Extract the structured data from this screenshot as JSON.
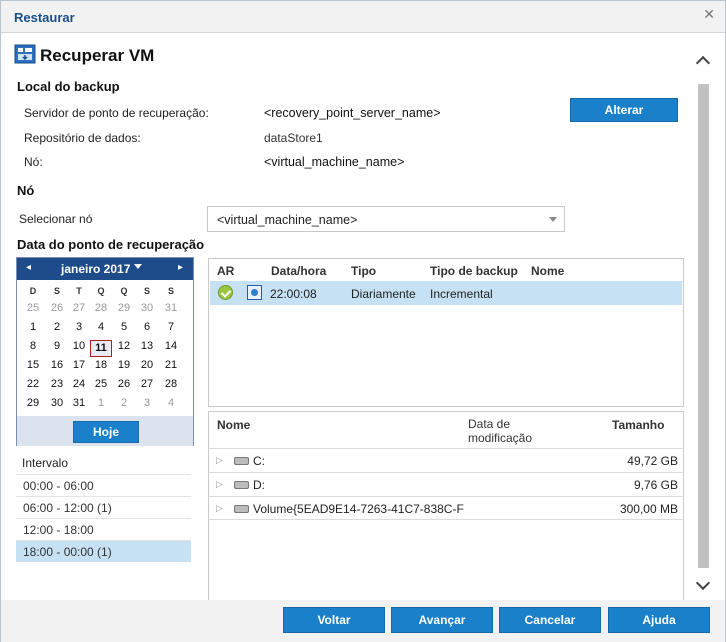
{
  "window": {
    "title": "Restaurar"
  },
  "header": {
    "title": "Recuperar VM"
  },
  "backup": {
    "section": "Local do backup",
    "server_label": "Servidor de ponto de recuperação:",
    "server_value": "<recovery_point_server_name>",
    "store_label": "Repositório de dados:",
    "store_value": "dataStore1",
    "node_label": "Nó:",
    "node_value": "<virtual_machine_name>",
    "change_button": "Alterar"
  },
  "node": {
    "section": "Nó",
    "select_label": "Selecionar nó",
    "select_value": "<virtual_machine_name>"
  },
  "recovery": {
    "section": "Data do ponto de recuperação"
  },
  "calendar": {
    "month": "janeiro 2017",
    "prev": "◂",
    "next": "▸",
    "dow": [
      "D",
      "S",
      "T",
      "Q",
      "Q",
      "S",
      "S"
    ],
    "weeks": [
      [
        "25",
        "26",
        "27",
        "28",
        "29",
        "30",
        "31"
      ],
      [
        "1",
        "2",
        "3",
        "4",
        "5",
        "6",
        "7"
      ],
      [
        "8",
        "9",
        "10",
        "11",
        "12",
        "13",
        "14"
      ],
      [
        "15",
        "16",
        "17",
        "18",
        "19",
        "20",
        "21"
      ],
      [
        "22",
        "23",
        "24",
        "25",
        "26",
        "27",
        "28"
      ],
      [
        "29",
        "30",
        "31",
        "1",
        "2",
        "3",
        "4"
      ]
    ],
    "today_button": "Hoje",
    "selected": "11"
  },
  "intervals": {
    "header": "Intervalo",
    "items": [
      "00:00 - 06:00",
      "06:00 - 12:00   (1)",
      "12:00 - 18:00",
      "18:00 - 00:00   (1)"
    ]
  },
  "points_table": {
    "headers": {
      "ar": "AR",
      "datetime": "Data/hora",
      "type": "Tipo",
      "backup_type": "Tipo de backup",
      "name": "Nome"
    },
    "rows": [
      {
        "time": "22:00:08",
        "type": "Diariamente",
        "backup_type": "Incremental",
        "name": ""
      }
    ]
  },
  "files_table": {
    "headers": {
      "name": "Nome",
      "modified_1": "Data de",
      "modified_2": "modificação",
      "size": "Tamanho"
    },
    "rows": [
      {
        "name": "C:",
        "size": "49,72 GB"
      },
      {
        "name": "D:",
        "size": "9,76 GB"
      },
      {
        "name": "Volume{5EAD9E14-7263-41C7-838C-F",
        "size": "300,00 MB"
      }
    ]
  },
  "footer": {
    "back": "Voltar",
    "next": "Avançar",
    "cancel": "Cancelar",
    "help": "Ajuda"
  },
  "colors": {
    "accent": "#1a80c9",
    "title": "#1a4f8c",
    "calendar_header": "#1e4b8a",
    "selection": "#c6e0f4"
  }
}
